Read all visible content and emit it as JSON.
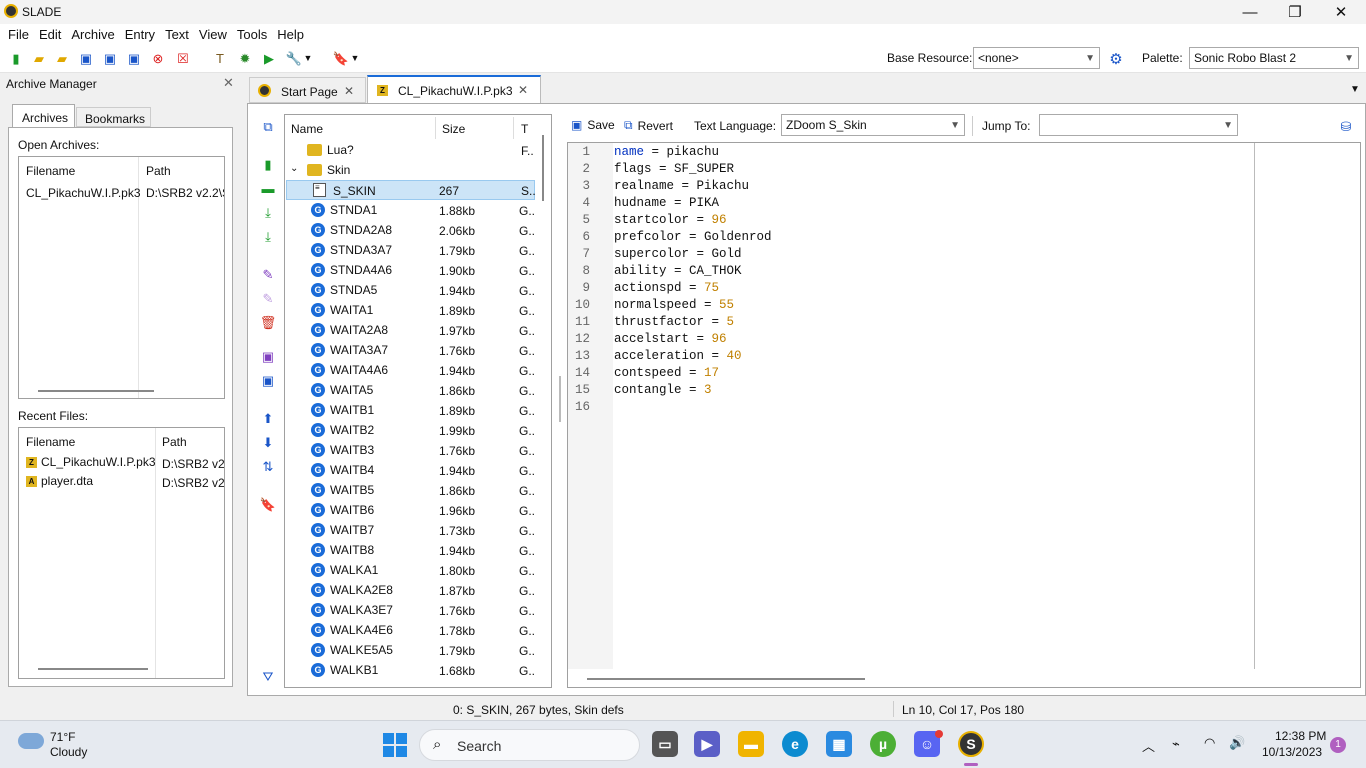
{
  "window": {
    "title": "SLADE"
  },
  "menu": [
    "File",
    "Edit",
    "Archive",
    "Entry",
    "Text",
    "View",
    "Tools",
    "Help"
  ],
  "toolbar": {
    "base_resource_label": "Base Resource:",
    "base_resource_value": "<none>",
    "palette_label": "Palette:",
    "palette_value": "Sonic Robo Blast 2"
  },
  "archive_manager": {
    "title": "Archive Manager",
    "tabs": [
      "Archives",
      "Bookmarks"
    ],
    "open_archives_label": "Open Archives:",
    "open_columns": [
      "Filename",
      "Path"
    ],
    "open_rows": [
      {
        "filename": "CL_PikachuW.I.P.pk3",
        "path": "D:\\SRB2 v2.2\\S"
      }
    ],
    "recent_label": "Recent Files:",
    "recent_columns": [
      "Filename",
      "Path"
    ],
    "recent_rows": [
      {
        "icon": "Z",
        "filename": "CL_PikachuW.I.P.pk3",
        "path": "D:\\SRB2 v2."
      },
      {
        "icon": "A",
        "filename": "player.dta",
        "path": "D:\\SRB2 v2."
      }
    ]
  },
  "tabs": [
    {
      "label": "Start Page"
    },
    {
      "label": "CL_PikachuW.I.P.pk3"
    }
  ],
  "entry_list": {
    "columns": [
      "Name",
      "Size",
      "T"
    ],
    "folders": [
      {
        "name": "Lua?",
        "type": "F.."
      },
      {
        "name": "Skin",
        "type": ""
      }
    ],
    "selected": {
      "name": "S_SKIN",
      "size": "267",
      "type": "S.."
    },
    "entries": [
      {
        "name": "STNDA1",
        "size": "1.88kb"
      },
      {
        "name": "STNDA2A8",
        "size": "2.06kb"
      },
      {
        "name": "STNDA3A7",
        "size": "1.79kb"
      },
      {
        "name": "STNDA4A6",
        "size": "1.90kb"
      },
      {
        "name": "STNDA5",
        "size": "1.94kb"
      },
      {
        "name": "WAITA1",
        "size": "1.89kb"
      },
      {
        "name": "WAITA2A8",
        "size": "1.97kb"
      },
      {
        "name": "WAITA3A7",
        "size": "1.76kb"
      },
      {
        "name": "WAITA4A6",
        "size": "1.94kb"
      },
      {
        "name": "WAITA5",
        "size": "1.86kb"
      },
      {
        "name": "WAITB1",
        "size": "1.89kb"
      },
      {
        "name": "WAITB2",
        "size": "1.99kb"
      },
      {
        "name": "WAITB3",
        "size": "1.76kb"
      },
      {
        "name": "WAITB4",
        "size": "1.94kb"
      },
      {
        "name": "WAITB5",
        "size": "1.86kb"
      },
      {
        "name": "WAITB6",
        "size": "1.96kb"
      },
      {
        "name": "WAITB7",
        "size": "1.73kb"
      },
      {
        "name": "WAITB8",
        "size": "1.94kb"
      },
      {
        "name": "WALKA1",
        "size": "1.80kb"
      },
      {
        "name": "WALKA2E8",
        "size": "1.87kb"
      },
      {
        "name": "WALKA3E7",
        "size": "1.76kb"
      },
      {
        "name": "WALKA4E6",
        "size": "1.78kb"
      },
      {
        "name": "WALKE5A5",
        "size": "1.79kb"
      },
      {
        "name": "WALKB1",
        "size": "1.68kb"
      }
    ],
    "entry_type": "G.."
  },
  "editor": {
    "save": "Save",
    "revert": "Revert",
    "language_label": "Text Language:",
    "language_value": "ZDoom S_Skin",
    "jump_label": "Jump To:",
    "jump_value": "",
    "lines": [
      {
        "key": "name",
        "op": " = ",
        "val": "pikachu",
        "num": false
      },
      {
        "key": "flags",
        "op": " = ",
        "val": "SF_SUPER",
        "num": false
      },
      {
        "key": "realname",
        "op": " = ",
        "val": "Pikachu",
        "num": false
      },
      {
        "key": "hudname",
        "op": " = ",
        "val": "PIKA",
        "num": false
      },
      {
        "key": "startcolor",
        "op": " = ",
        "val": "96",
        "num": true
      },
      {
        "key": "prefcolor",
        "op": " = ",
        "val": "Goldenrod",
        "num": false
      },
      {
        "key": "supercolor",
        "op": " = ",
        "val": "Gold",
        "num": false
      },
      {
        "key": "ability",
        "op": " = ",
        "val": "CA_THOK",
        "num": false
      },
      {
        "key": "actionspd",
        "op": " = ",
        "val": "75",
        "num": true
      },
      {
        "key": "normalspeed",
        "op": " = ",
        "val": "55",
        "num": true
      },
      {
        "key": "thrustfactor",
        "op": " = ",
        "val": "5",
        "num": true
      },
      {
        "key": "accelstart",
        "op": " = ",
        "val": "96",
        "num": true
      },
      {
        "key": "acceleration",
        "op": " = ",
        "val": "40",
        "num": true
      },
      {
        "key": "contspeed",
        "op": " = ",
        "val": "17",
        "num": true
      },
      {
        "key": "contangle",
        "op": " = ",
        "val": "3",
        "num": true
      },
      {
        "key": "",
        "op": "",
        "val": "",
        "num": false
      }
    ]
  },
  "status": {
    "entry": "0: S_SKIN, 267 bytes, Skin defs",
    "cursor": "Ln 10, Col 17, Pos 180"
  },
  "taskbar": {
    "temp": "71°F",
    "weather": "Cloudy",
    "search": "Search",
    "time": "12:38 PM",
    "date": "10/13/2023",
    "notif": "1"
  }
}
